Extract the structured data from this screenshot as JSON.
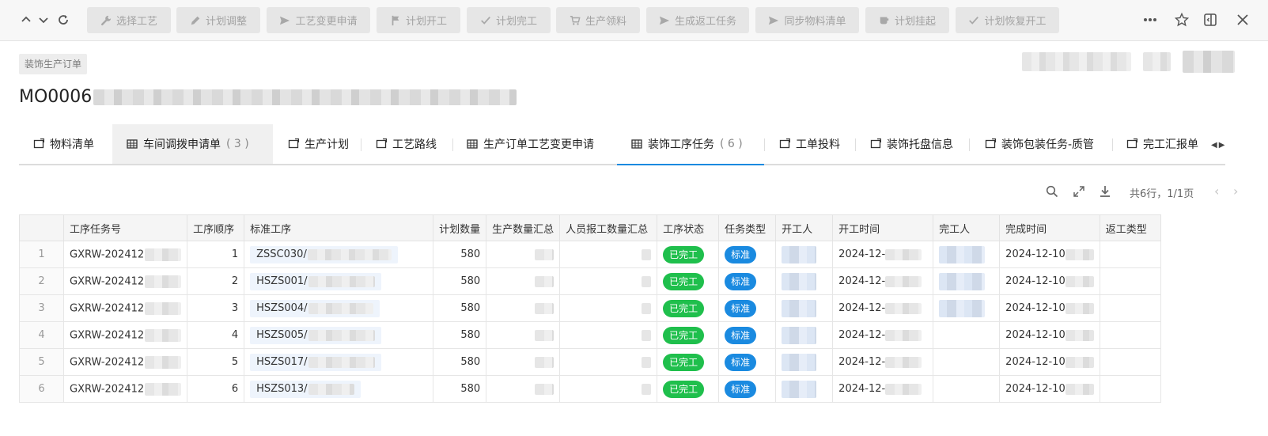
{
  "toolbar": {
    "buttons": [
      {
        "label": "选择工艺",
        "icon": "wrench-icon"
      },
      {
        "label": "计划调整",
        "icon": "pencil-icon"
      },
      {
        "label": "工艺变更申请",
        "icon": "send-icon"
      },
      {
        "label": "计划开工",
        "icon": "flag-icon"
      },
      {
        "label": "计划完工",
        "icon": "check-icon"
      },
      {
        "label": "生产领料",
        "icon": "cart-icon"
      },
      {
        "label": "生成返工任务",
        "icon": "send-icon"
      },
      {
        "label": "同步物料清单",
        "icon": "send-icon"
      },
      {
        "label": "计划挂起",
        "icon": "cup-icon"
      },
      {
        "label": "计划恢复开工",
        "icon": "check-icon"
      }
    ]
  },
  "header": {
    "tag": "装饰生产订单",
    "order_no": "MO0006"
  },
  "tabs": [
    {
      "label": "物料清单",
      "count": ""
    },
    {
      "label": "车间调拨申请单",
      "count": "( 3 )"
    },
    {
      "label": "生产计划",
      "count": ""
    },
    {
      "label": "工艺路线",
      "count": ""
    },
    {
      "label": "生产订单工艺变更申请",
      "count": ""
    },
    {
      "label": "装饰工序任务",
      "count": "( 6 )"
    },
    {
      "label": "工单投料",
      "count": ""
    },
    {
      "label": "装饰托盘信息",
      "count": ""
    },
    {
      "label": "装饰包装任务-质管",
      "count": ""
    },
    {
      "label": "完工汇报单",
      "count": ""
    }
  ],
  "pagination": {
    "summary": "共6行，1/1页"
  },
  "table": {
    "columns": [
      "工序任务号",
      "工序顺序",
      "标准工序",
      "计划数量",
      "生产数量汇总",
      "人员报工数量汇总",
      "工序状态",
      "任务类型",
      "开工人",
      "开工时间",
      "完工人",
      "完成时间",
      "返工类型"
    ],
    "rows": [
      {
        "idx": "1",
        "task_no": "GXRW-202412",
        "seq": "1",
        "std_op": "ZSSC030/",
        "plan_qty": "580",
        "status": "已完工",
        "type": "标准",
        "start_time": "2024-12-",
        "finish_time": "2024-12-10"
      },
      {
        "idx": "2",
        "task_no": "GXRW-202412",
        "seq": "2",
        "std_op": "HSZS001/",
        "plan_qty": "580",
        "status": "已完工",
        "type": "标准",
        "start_time": "2024-12-",
        "finish_time": "2024-12-10"
      },
      {
        "idx": "3",
        "task_no": "GXRW-202412",
        "seq": "3",
        "std_op": "HSZS004/",
        "plan_qty": "580",
        "status": "已完工",
        "type": "标准",
        "start_time": "2024-12-",
        "finish_time": "2024-12-10"
      },
      {
        "idx": "4",
        "task_no": "GXRW-202412",
        "seq": "4",
        "std_op": "HSZS005/",
        "plan_qty": "580",
        "status": "已完工",
        "type": "标准",
        "start_time": "2024-12-",
        "finish_time": "2024-12-10"
      },
      {
        "idx": "5",
        "task_no": "GXRW-202412",
        "seq": "5",
        "std_op": "HSZS017/",
        "plan_qty": "580",
        "status": "已完工",
        "type": "标准",
        "start_time": "2024-12-",
        "finish_time": "2024-12-10"
      },
      {
        "idx": "6",
        "task_no": "GXRW-202412",
        "seq": "6",
        "std_op": "HSZS013/",
        "plan_qty": "580",
        "status": "已完工",
        "type": "标准",
        "start_time": "2024-12-",
        "finish_time": "2024-12-10"
      }
    ]
  },
  "colors": {
    "accent": "#1a8ae0",
    "status_done": "#1fbf4c",
    "type_standard": "#1a8ae0"
  }
}
